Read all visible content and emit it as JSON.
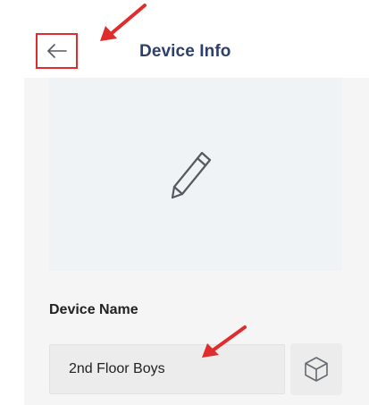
{
  "header": {
    "title": "Device Info",
    "back_icon": "arrow-left-icon"
  },
  "photo": {
    "edit_icon": "pencil-icon"
  },
  "form": {
    "device_name_label": "Device Name",
    "device_name_value": "2nd Floor Boys",
    "box_icon": "cube-icon"
  },
  "colors": {
    "title": "#2f3f6b",
    "highlight": "#e02c2c",
    "panel_bg": "#f5f5f5",
    "photo_bg": "#f0f3f6"
  }
}
